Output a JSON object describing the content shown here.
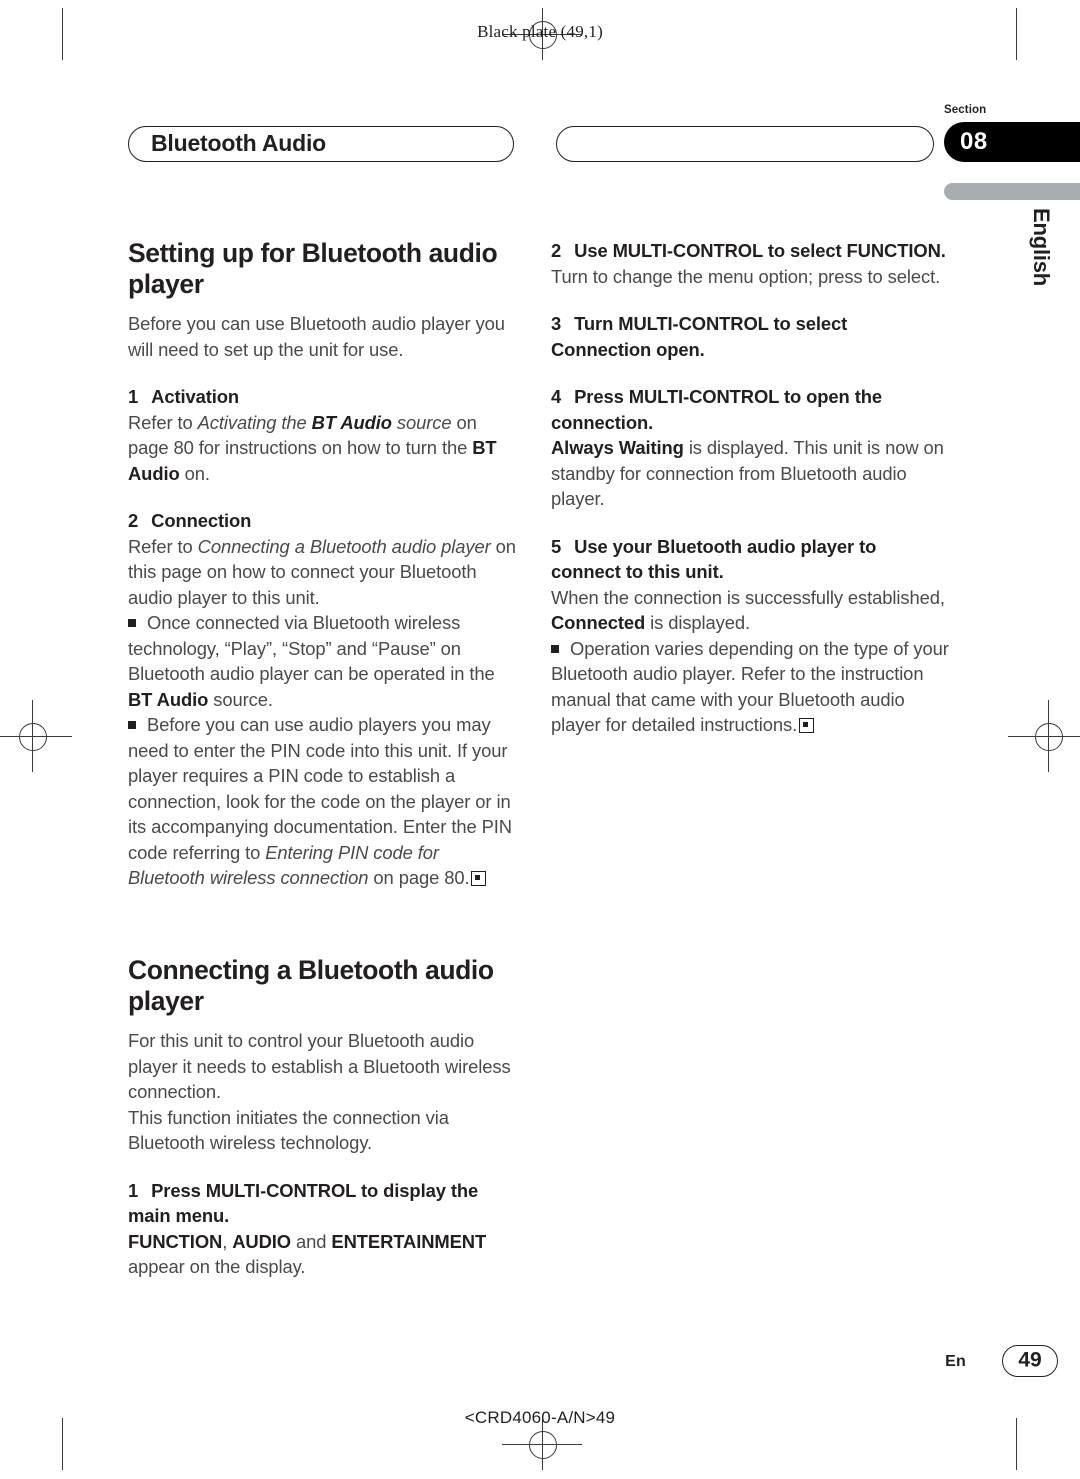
{
  "print_marks": {
    "plate_note": "Black plate (49,1)",
    "print_code": "<CRD4060-A/N>49"
  },
  "header": {
    "chapter_title": "Bluetooth Audio",
    "section_label": "Section",
    "section_number": "08",
    "language_tab": "English"
  },
  "left_column": {
    "heading_1": "Setting up for Bluetooth audio player",
    "intro": "Before you can use Bluetooth audio player you will need to set up the unit for use.",
    "step1": {
      "number": "1",
      "title": "Activation",
      "body_before_italic": "Refer to ",
      "body_italic": "Activating the ",
      "body_bold_italic": "BT Audio",
      "body_italic_2": " source",
      "body_plain": " on page 80 for instructions on how to turn the ",
      "body_bold_2": "BT Audio",
      "body_end": " on."
    },
    "step2": {
      "number": "2",
      "title": "Connection",
      "body_before_italic": "Refer to ",
      "body_italic": "Connecting a Bluetooth audio player",
      "body_plain": " on this page on how to connect your Bluetooth audio player to this unit."
    },
    "note1": {
      "text_start": "Once connected via Bluetooth wireless technology, “Play”, “Stop” and “Pause” on Bluetooth audio player can be operated in the ",
      "bold": "BT Audio",
      "text_end": " source."
    },
    "note2": {
      "text_start": "Before you can use audio players you may need to enter the PIN code into this unit. If your player requires a PIN code to establish a connection, look for the code on the player or in its accompanying documentation. Enter the PIN code referring to ",
      "italic": "Entering PIN code for Bluetooth wireless connection",
      "text_end": " on page 80."
    },
    "heading_2": "Connecting a Bluetooth audio player",
    "para_1": "For this unit to control your Bluetooth audio player it needs to establish a Bluetooth wireless connection.",
    "para_2": "This function initiates the connection via Bluetooth wireless technology.",
    "step3": {
      "number": "1",
      "title": "Press MULTI-CONTROL to display the main menu.",
      "body_bold_1": "FUNCTION",
      "body_sep_1": ", ",
      "body_bold_2": "AUDIO",
      "body_sep_2": " and ",
      "body_bold_3": "ENTERTAINMENT",
      "body_end": " appear on the display."
    }
  },
  "right_column": {
    "step2": {
      "number": "2",
      "title": "Use MULTI-CONTROL to select FUNCTION.",
      "body": "Turn to change the menu option; press to select."
    },
    "step3": {
      "number": "3",
      "title": "Turn MULTI-CONTROL to select Connection open."
    },
    "step4": {
      "number": "4",
      "title": "Press MULTI-CONTROL to open the connection.",
      "body_bold": "Always Waiting",
      "body_text": " is displayed. This unit is now on standby for connection from Bluetooth audio player."
    },
    "step5": {
      "number": "5",
      "title": "Use your Bluetooth audio player to connect to this unit.",
      "body_start": "When the connection is successfully established, ",
      "body_bold": "Connected",
      "body_end": " is displayed."
    },
    "note": {
      "text": "Operation varies depending on the type of your Bluetooth audio player. Refer to the instruction manual that came with your Bluetooth audio player for detailed instructions."
    }
  },
  "footer": {
    "language": "En",
    "page_number": "49"
  }
}
